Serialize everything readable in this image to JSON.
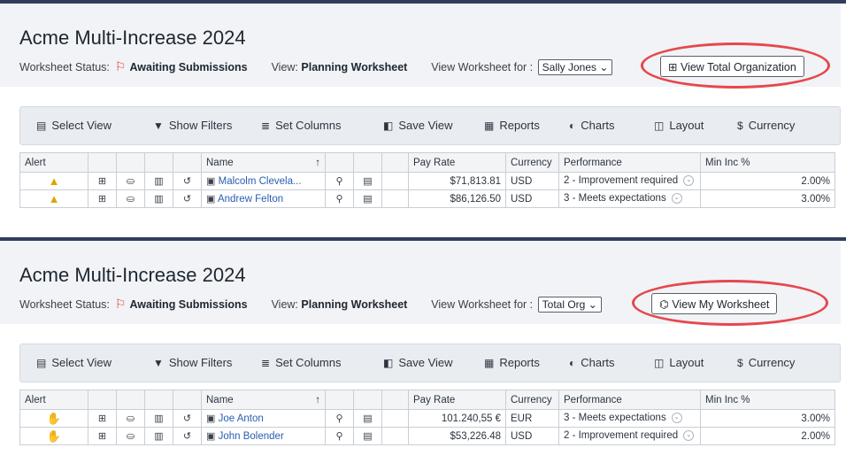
{
  "panels": [
    {
      "title": "Acme Multi-Increase 2024",
      "status_label": "Worksheet Status:",
      "status_value": "Awaiting Submissions",
      "view_label": "View:",
      "view_value": "Planning Worksheet",
      "worksheet_for_label": "View Worksheet for :",
      "worksheet_for_value": "Sally Jones",
      "action_button": "View Total Organization",
      "action_icon": "org-chart-icon",
      "rows": [
        {
          "alert_icon": "warning-icon",
          "name": "Malcolm Clevela...",
          "pay_rate": "$71,813.81",
          "currency": "USD",
          "performance": "2 - Improvement required",
          "min_inc": "2.00%"
        },
        {
          "alert_icon": "warning-icon",
          "name": "Andrew Felton",
          "pay_rate": "$86,126.50",
          "currency": "USD",
          "performance": "3 - Meets expectations",
          "min_inc": "3.00%"
        }
      ]
    },
    {
      "title": "Acme Multi-Increase 2024",
      "status_label": "Worksheet Status:",
      "status_value": "Awaiting Submissions",
      "view_label": "View:",
      "view_value": "Planning Worksheet",
      "worksheet_for_label": "View Worksheet for :",
      "worksheet_for_value": "Total Org",
      "action_button": "View My Worksheet",
      "action_icon": "hierarchy-icon",
      "rows": [
        {
          "alert_icon": "stop-hand-icon",
          "name": "Joe Anton",
          "pay_rate": "101.240,55 €",
          "currency": "EUR",
          "performance": "3 - Meets expectations",
          "min_inc": "3.00%"
        },
        {
          "alert_icon": "stop-hand-icon",
          "name": "John Bolender",
          "pay_rate": "$53,226.48",
          "currency": "USD",
          "performance": "2 - Improvement required",
          "min_inc": "2.00%"
        }
      ]
    }
  ],
  "toolbar": {
    "select_view": "Select View",
    "show_filters": "Show Filters",
    "set_columns": "Set Columns",
    "save_view": "Save View",
    "reports": "Reports",
    "charts": "Charts",
    "layout": "Layout",
    "currency": "Currency"
  },
  "columns": {
    "alert": "Alert",
    "name": "Name",
    "pay_rate": "Pay Rate",
    "currency": "Currency",
    "performance": "Performance",
    "min_inc": "Min Inc %"
  },
  "colors": {
    "highlight": "#e5484d",
    "flag": "#e0412b",
    "header_bar": "#2f3e5c"
  }
}
